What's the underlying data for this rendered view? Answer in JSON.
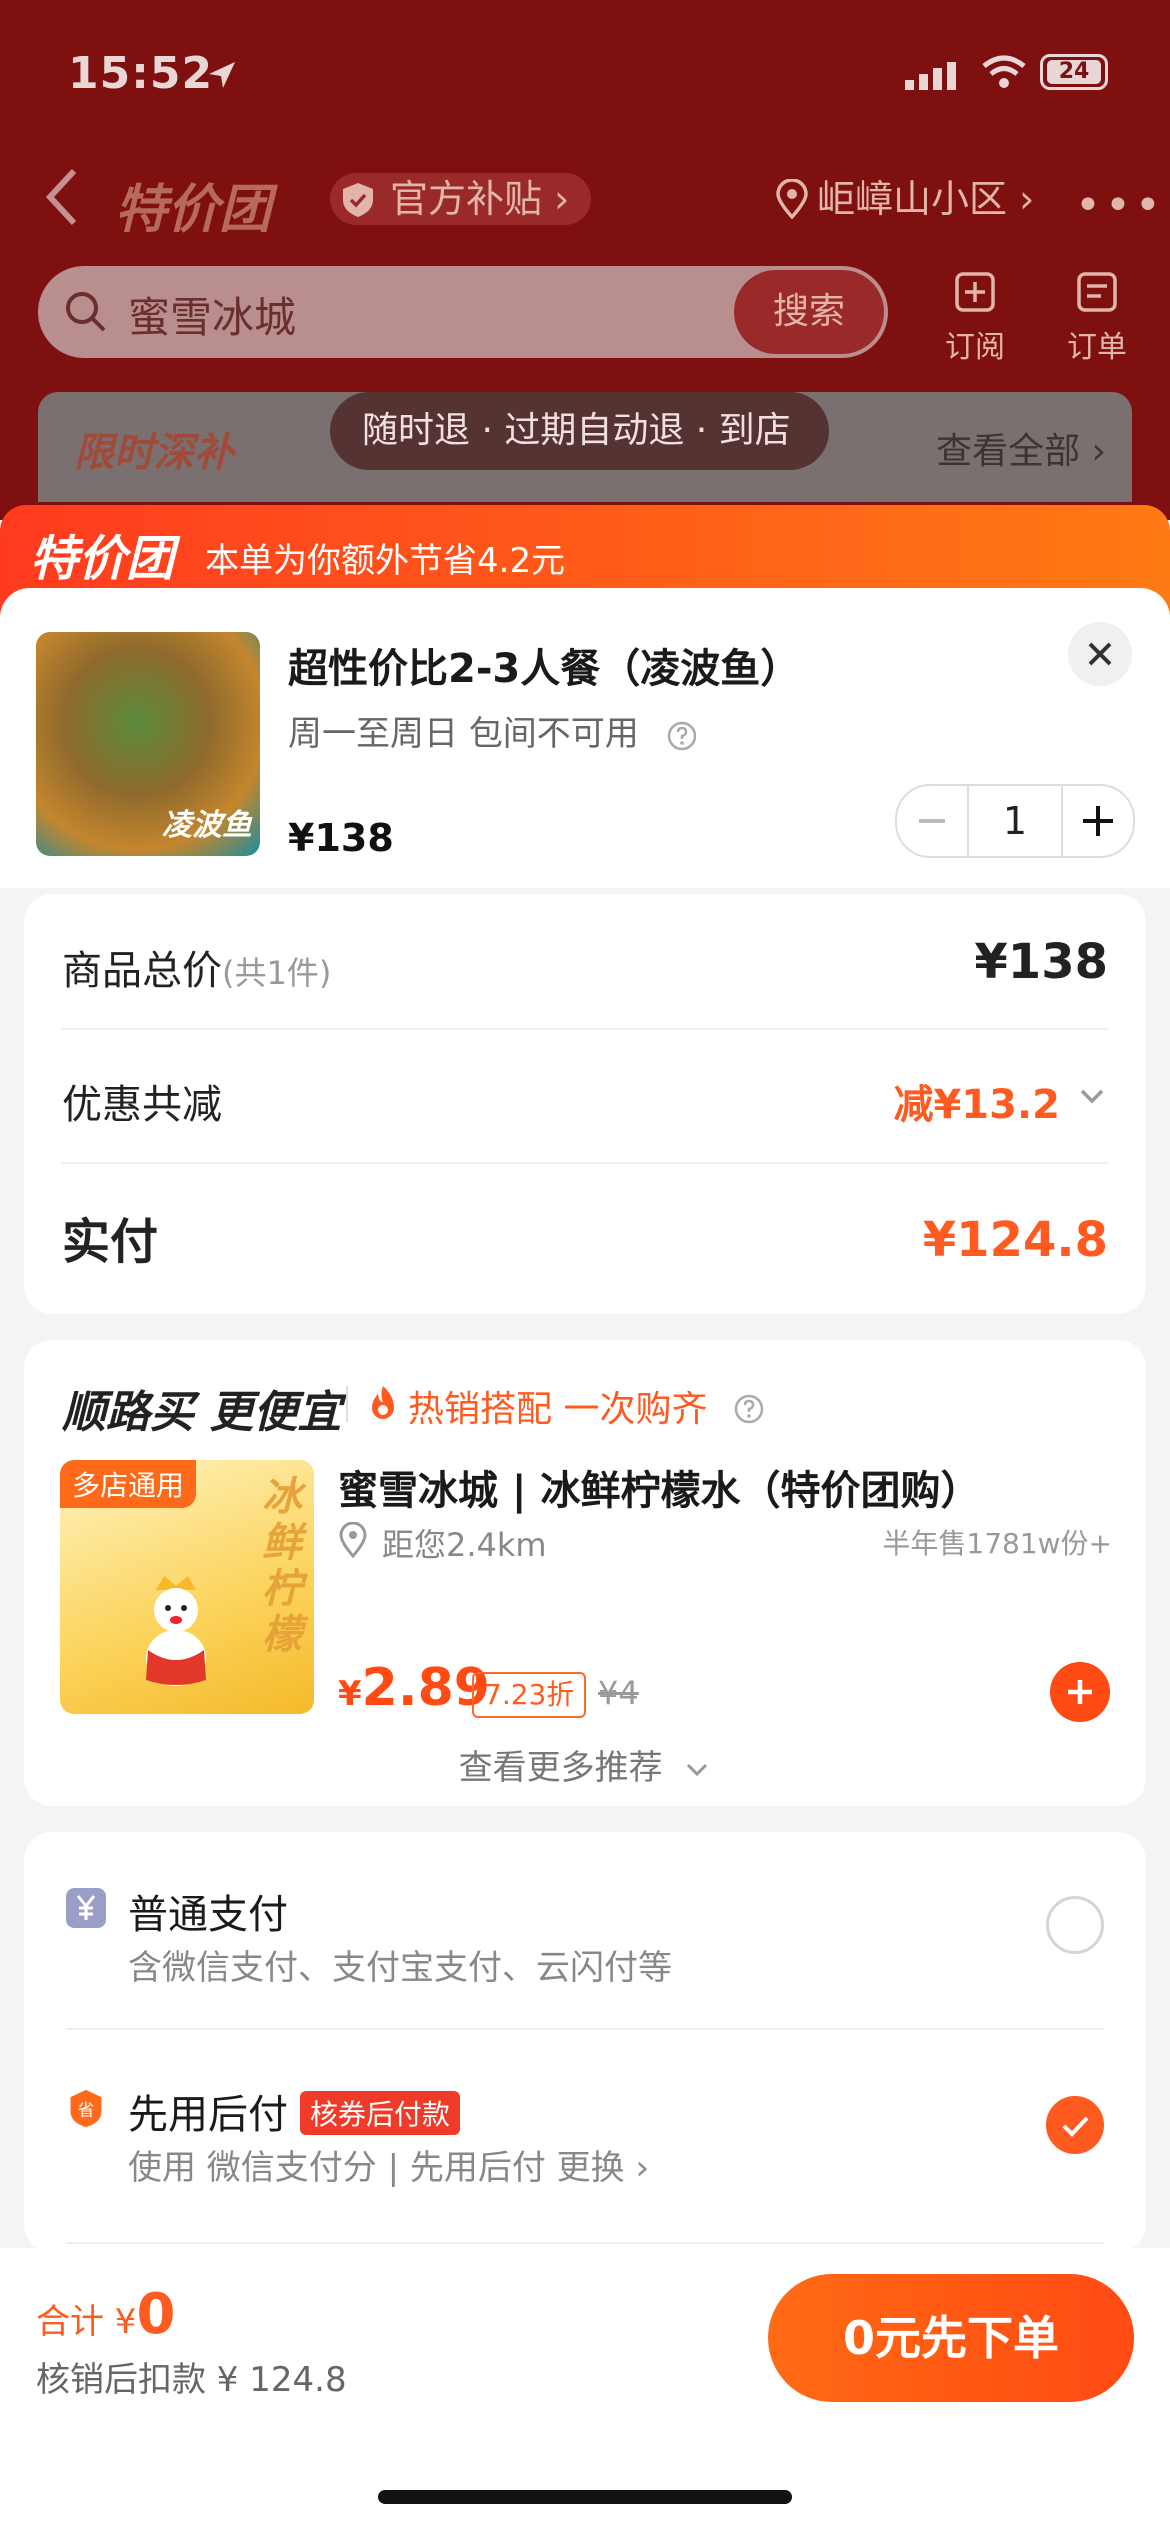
{
  "status": {
    "time": "15:52",
    "battery": "24"
  },
  "background": {
    "brand": "特价团",
    "subsidy": "官方补贴 ›",
    "location": "岠嶂山小区 ›",
    "search_query": "蜜雪冰城",
    "search_button": "搜索",
    "subscribe": "订阅",
    "orders": "订单",
    "promo_label": "限时深补",
    "view_all": "查看全部 ›",
    "toast": "随时退 · 过期自动退 · 到店"
  },
  "banner": {
    "logo": "特价团",
    "text": "本单为你额外节省4.2元"
  },
  "product": {
    "title": "超性价比2-3人餐（凌波鱼）",
    "subtitle": "周一至周日 包间不可用",
    "price": "¥138",
    "image_label": "凌波鱼",
    "quantity": "1"
  },
  "summary": {
    "total_label": "商品总价",
    "total_count": "(共1件)",
    "total_value": "¥138",
    "discount_label": "优惠共减",
    "discount_value": "减¥13.2",
    "paid_label": "实付",
    "paid_value": "¥124.8"
  },
  "recommend": {
    "heading": "顺路买 更便宜",
    "hot": "热销搭配 一次购齐",
    "image_tag": "多店通用",
    "image_text": "冰鲜柠檬",
    "title": "蜜雪冰城 | 冰鲜柠檬水（特价团购）",
    "distance": "距您2.4km",
    "sold": "半年售1781w份+",
    "price_symbol": "¥",
    "price": "2.89",
    "discount": "7.23折",
    "original": "¥4",
    "more": "查看更多推荐"
  },
  "payment": {
    "normal_name": "普通支付",
    "normal_desc": "含微信支付、支付宝支付、云闪付等",
    "later_name": "先用后付",
    "later_tag": "核券后付款",
    "later_desc": "使用 微信支付分 | 先用后付  更换 ›"
  },
  "bottom": {
    "total_label": "合计 ¥",
    "total_value": "0",
    "after_text": "核销后扣款 ¥ 124.8",
    "submit": "0元先下单"
  },
  "colors": {
    "accent": "#ff5a1f",
    "background_dim": "#7e1010"
  }
}
